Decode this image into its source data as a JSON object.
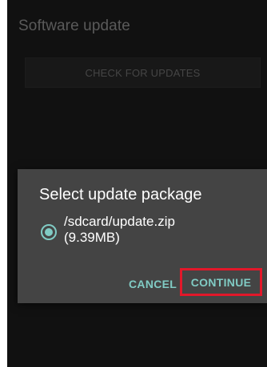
{
  "app": {
    "title": "Software update",
    "check_button_label": "CHECK FOR UPDATES"
  },
  "dialog": {
    "title": "Select update package",
    "option_label": "/sdcard/update.zip (9.39MB)",
    "option_selected": true,
    "cancel_label": "CANCEL",
    "continue_label": "CONTINUE"
  },
  "colors": {
    "background": "#1b1b1b",
    "dialog_background": "#444444",
    "accent": "#80cbc4",
    "highlight_box": "#e2182a"
  },
  "icons": {
    "radio": "radio-selected-icon"
  }
}
